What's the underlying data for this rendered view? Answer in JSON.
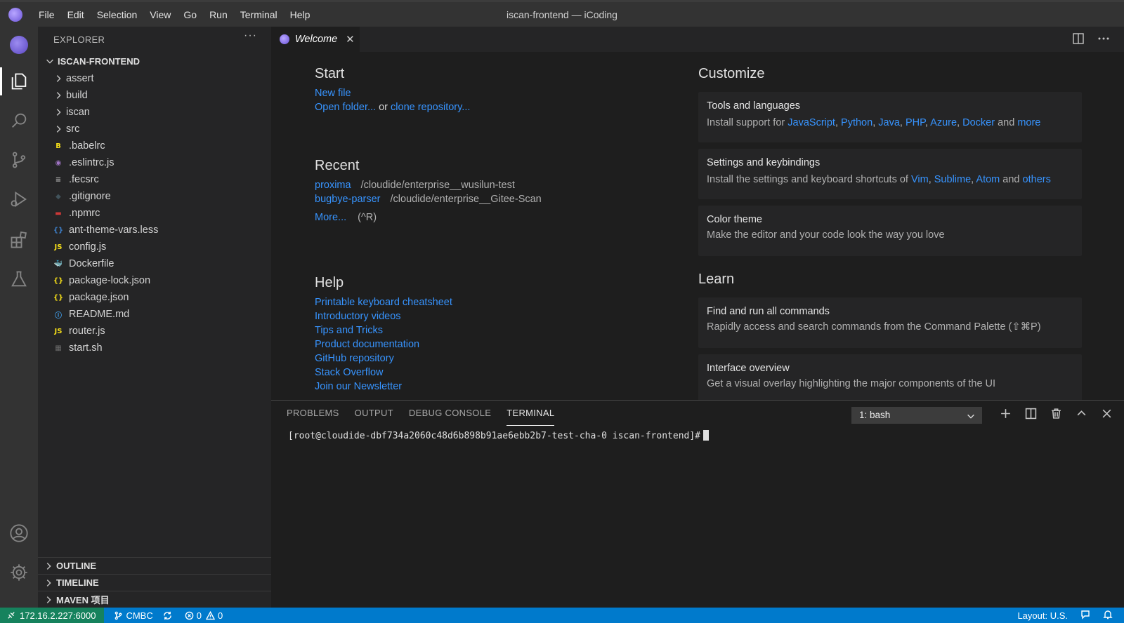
{
  "window": {
    "title": "iscan-frontend — iCoding"
  },
  "menu": [
    "File",
    "Edit",
    "Selection",
    "View",
    "Go",
    "Run",
    "Terminal",
    "Help"
  ],
  "sidebar": {
    "header": "EXPLORER",
    "root": "ISCAN-FRONTEND",
    "folders": [
      "assert",
      "build",
      "iscan",
      "src"
    ],
    "files": [
      {
        "name": ".babelrc",
        "icon": "babel-icon",
        "color": "#f5de19"
      },
      {
        "name": ".eslintrc.js",
        "icon": "eslint-icon",
        "color": "#a074c4"
      },
      {
        "name": ".fecsrc",
        "icon": "config-lines-icon",
        "color": "#b0b0b0"
      },
      {
        "name": ".gitignore",
        "icon": "git-icon",
        "color": "#41535b"
      },
      {
        "name": ".npmrc",
        "icon": "npm-icon",
        "color": "#cb3837"
      },
      {
        "name": "ant-theme-vars.less",
        "icon": "less-braces-icon",
        "color": "#3d7ec7"
      },
      {
        "name": "config.js",
        "icon": "js-icon",
        "color": "#f5de19"
      },
      {
        "name": "Dockerfile",
        "icon": "docker-icon",
        "color": "#2496ed"
      },
      {
        "name": "package-lock.json",
        "icon": "json-icon",
        "color": "#f5de19"
      },
      {
        "name": "package.json",
        "icon": "json-icon",
        "color": "#f5de19"
      },
      {
        "name": "README.md",
        "icon": "info-icon",
        "color": "#42a5f5"
      },
      {
        "name": "router.js",
        "icon": "js-icon",
        "color": "#f5de19"
      },
      {
        "name": "start.sh",
        "icon": "shell-icon",
        "color": "#6a6a6a"
      }
    ],
    "file_glyphs": [
      "B",
      "◉",
      "≡",
      "◆",
      "▬",
      "{}",
      "JS",
      "🐳",
      "{}",
      "{}",
      "ⓘ",
      "JS",
      "▦"
    ],
    "sections": [
      "OUTLINE",
      "TIMELINE",
      "MAVEN 项目"
    ]
  },
  "tabs": [
    {
      "label": "Welcome",
      "close": "✕"
    }
  ],
  "welcome": {
    "start": {
      "heading": "Start",
      "new_file": "New file",
      "open_folder": "Open folder...",
      "or": "or",
      "clone": "clone repository..."
    },
    "recent": {
      "heading": "Recent",
      "items": [
        {
          "name": "proxima",
          "path": "/cloudide/enterprise__wusilun-test"
        },
        {
          "name": "bugbye-parser",
          "path": "/cloudide/enterprise__Gitee-Scan"
        }
      ],
      "more": "More...",
      "shortcut": "(^R)"
    },
    "help": {
      "heading": "Help",
      "links": [
        "Printable keyboard cheatsheet",
        "Introductory videos",
        "Tips and Tricks",
        "Product documentation",
        "GitHub repository",
        "Stack Overflow",
        "Join our Newsletter"
      ]
    },
    "customize": {
      "heading": "Customize",
      "tools": {
        "title": "Tools and languages",
        "prefix": "Install support for",
        "langs": [
          "JavaScript",
          "Python",
          "Java",
          "PHP",
          "Azure",
          "Docker"
        ],
        "and": "and",
        "more": "more"
      },
      "settings": {
        "title": "Settings and keybindings",
        "prefix": "Install the settings and keyboard shortcuts of",
        "editors": [
          "Vim",
          "Sublime",
          "Atom"
        ],
        "and": "and",
        "others": "others"
      },
      "color": {
        "title": "Color theme",
        "desc": "Make the editor and your code look the way you love"
      }
    },
    "learn": {
      "heading": "Learn",
      "commands": {
        "title": "Find and run all commands",
        "desc": "Rapidly access and search commands from the Command Palette (⇧⌘P)"
      },
      "overview": {
        "title": "Interface overview",
        "desc": "Get a visual overlay highlighting the major components of the UI"
      }
    }
  },
  "panel": {
    "tabs": [
      "PROBLEMS",
      "OUTPUT",
      "DEBUG CONSOLE",
      "TERMINAL"
    ],
    "active_tab": "TERMINAL",
    "terminal_select": "1: bash",
    "prompt": "[root@cloudide-dbf734a2060c48d6b898b91ae6ebb2b7-test-cha-0 iscan-frontend]#"
  },
  "statusbar": {
    "remote": "172.16.2.227:6000",
    "branch": "CMBC",
    "errors": "0",
    "warnings": "0",
    "layout": "Layout: U.S."
  },
  "colors": {
    "accent": "#007acc",
    "remote": "#16825d",
    "link": "#3794ff"
  }
}
